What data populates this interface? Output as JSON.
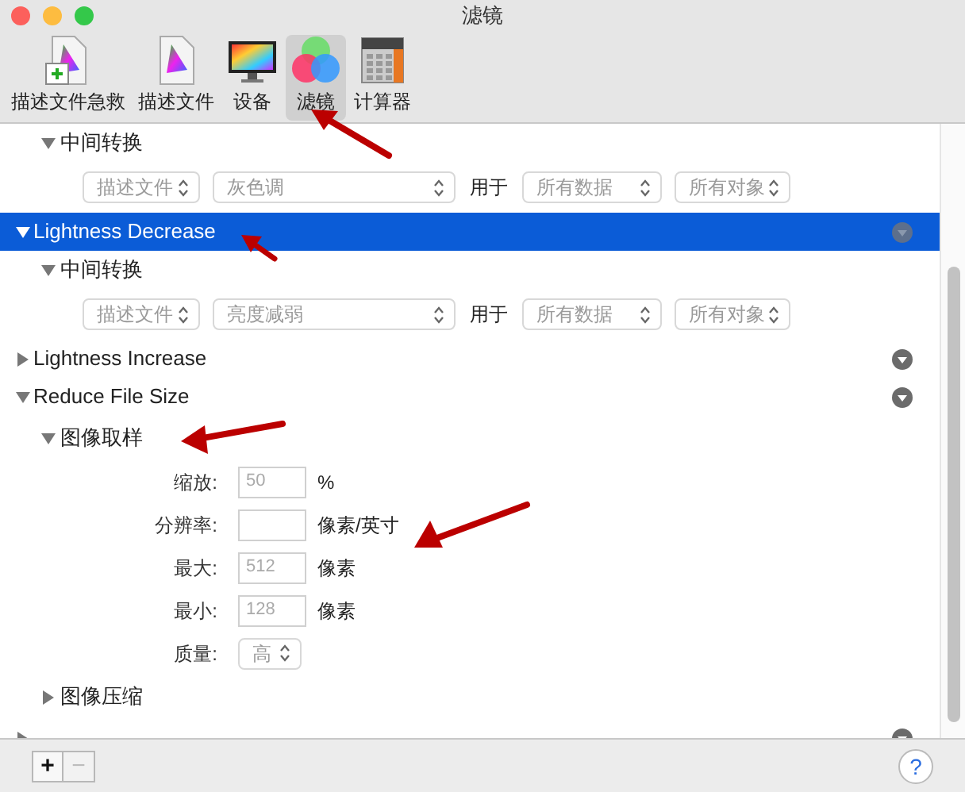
{
  "window": {
    "title": "滤镜"
  },
  "toolbar": [
    {
      "label": "描述文件急救",
      "kind": "doc-plus",
      "selected": false
    },
    {
      "label": "描述文件",
      "kind": "doc",
      "selected": false
    },
    {
      "label": "设备",
      "kind": "monitor",
      "selected": false
    },
    {
      "label": "滤镜",
      "kind": "circles",
      "selected": true
    },
    {
      "label": "计算器",
      "kind": "calculator",
      "selected": false
    }
  ],
  "tree": [
    {
      "kind": "transform",
      "label": "中间转换",
      "expanded": true,
      "controls": [
        {
          "kind": "popup",
          "value": "描述文件"
        },
        {
          "kind": "popup",
          "value": "灰色调"
        },
        {
          "kind": "label",
          "text": "用于"
        },
        {
          "kind": "popup",
          "value": "所有数据"
        },
        {
          "kind": "popup",
          "value": "所有对象"
        }
      ]
    },
    {
      "kind": "filter",
      "label": "Lightness Decrease",
      "expanded": true,
      "selected": true,
      "children": [
        {
          "kind": "transform",
          "label": "中间转换",
          "expanded": true,
          "controls": [
            {
              "kind": "popup",
              "value": "描述文件"
            },
            {
              "kind": "popup",
              "value": "亮度减弱"
            },
            {
              "kind": "label",
              "text": "用于"
            },
            {
              "kind": "popup",
              "value": "所有数据"
            },
            {
              "kind": "popup",
              "value": "所有对象"
            }
          ]
        }
      ]
    },
    {
      "kind": "filter",
      "label": "Lightness Increase",
      "expanded": false,
      "selected": false
    },
    {
      "kind": "filter",
      "label": "Reduce File Size",
      "expanded": true,
      "selected": false,
      "children": [
        {
          "kind": "section",
          "label": "图像取样",
          "expanded": true,
          "fields": [
            {
              "kind": "text",
              "label": "缩放:",
              "value": "50",
              "unit": "%"
            },
            {
              "kind": "text",
              "label": "分辨率:",
              "unit": "像素/英寸"
            },
            {
              "kind": "text",
              "label": "最大:",
              "value": "512",
              "unit": "像素"
            },
            {
              "kind": "text",
              "label": "最小:",
              "value": "128",
              "unit": "像素"
            },
            {
              "kind": "popup",
              "label": "质量:",
              "value": "高"
            }
          ]
        },
        {
          "kind": "section",
          "label": "图像压缩",
          "expanded": false
        }
      ]
    },
    {
      "kind": "filter",
      "expanded": false,
      "selected": false
    }
  ],
  "bottom_bar": {
    "add": "+",
    "remove": "−",
    "remove_disabled": true,
    "help": "?"
  }
}
